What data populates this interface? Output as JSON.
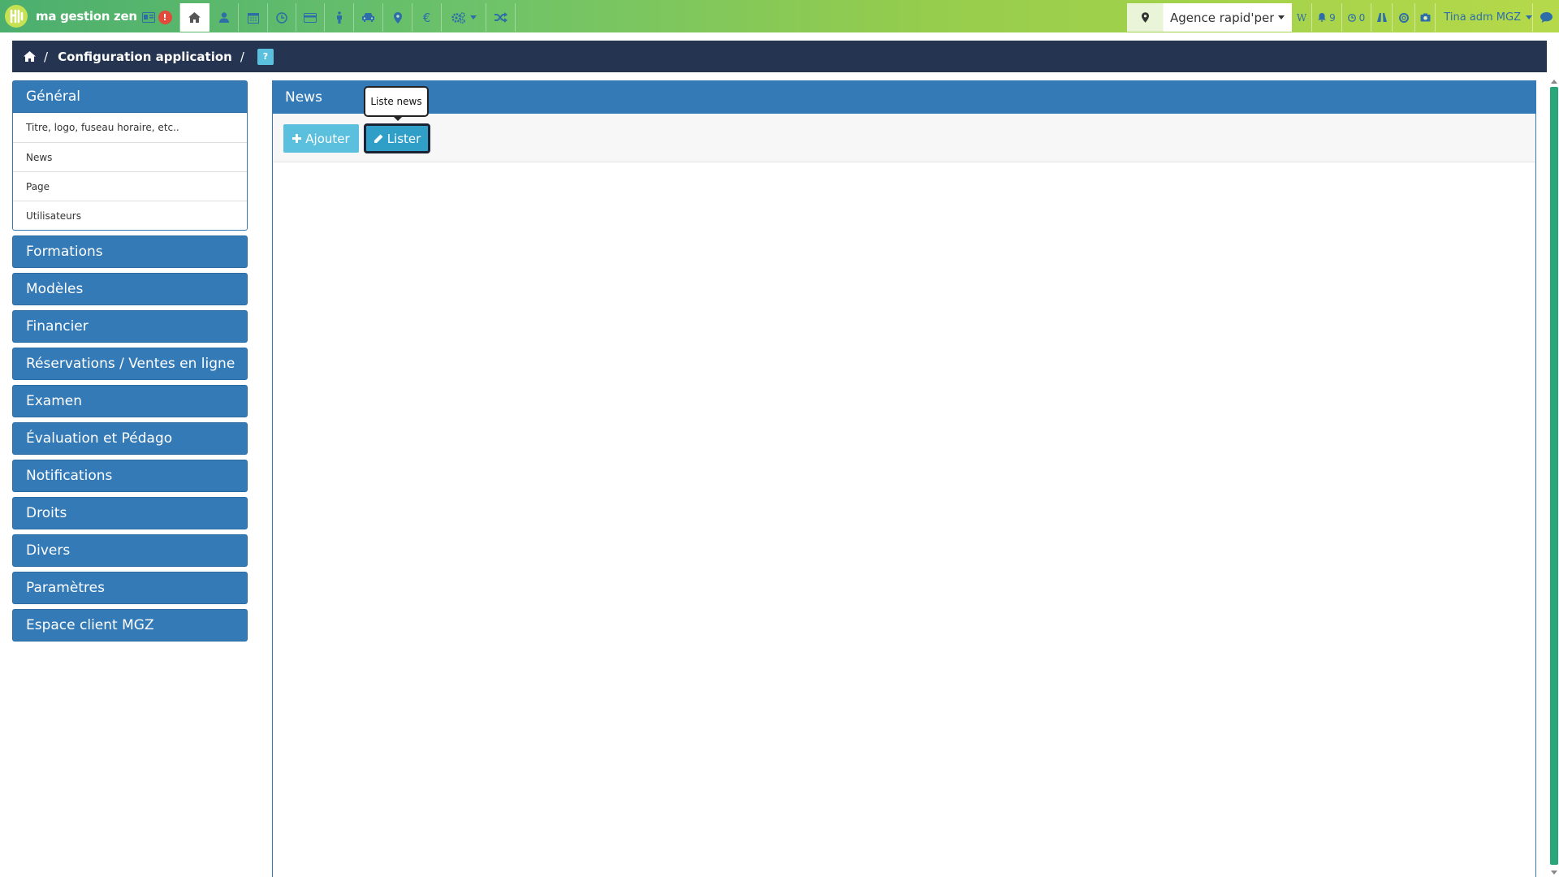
{
  "app": {
    "logo_text": "ma gestion zen",
    "logo_mark": "MG"
  },
  "topbar": {
    "alert_badge": "!",
    "nav_icons": [
      "id-card-icon",
      "home-icon",
      "user-icon",
      "calendar-icon",
      "clock-icon",
      "credit-card-icon",
      "person-icon",
      "car-icon",
      "map-marker-icon",
      "euro-icon",
      "gears-icon",
      "shuffle-icon"
    ],
    "agency": "Agence rapid'peri",
    "w_label": "W",
    "notifications_count": "9",
    "pending_count": "0",
    "user_name": "Tina adm MGZ"
  },
  "breadcrumb": {
    "title": "Configuration application",
    "separator": "/",
    "help": "?"
  },
  "sidebar": {
    "general": {
      "label": "Général",
      "items": [
        {
          "label": "Titre, logo, fuseau horaire, etc.."
        },
        {
          "label": "News"
        },
        {
          "label": "Page"
        },
        {
          "label": "Utilisateurs"
        }
      ]
    },
    "sections": [
      {
        "label": "Formations"
      },
      {
        "label": "Modèles"
      },
      {
        "label": "Financier"
      },
      {
        "label": "Réservations / Ventes en ligne"
      },
      {
        "label": "Examen"
      },
      {
        "label": "Évaluation et Pédago"
      },
      {
        "label": "Notifications"
      },
      {
        "label": "Droits"
      },
      {
        "label": "Divers"
      },
      {
        "label": "Paramètres"
      },
      {
        "label": "Espace client MGZ"
      }
    ]
  },
  "main": {
    "title": "News",
    "add_label": "Ajouter",
    "list_label": "Lister",
    "tooltip": "Liste news"
  },
  "colors": {
    "primary": "#337ab7",
    "info": "#5bc0de",
    "navy": "#253451",
    "danger": "#e04b3b"
  }
}
